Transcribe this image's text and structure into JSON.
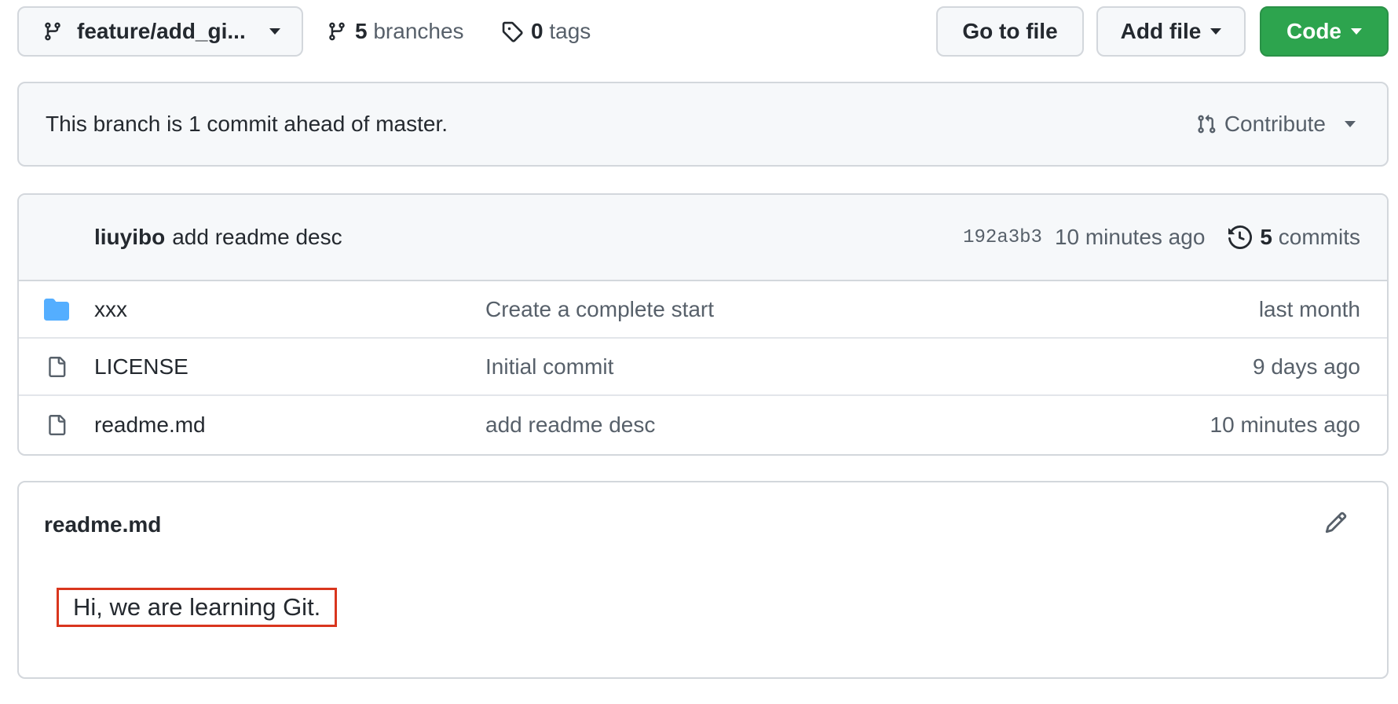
{
  "toolbar": {
    "branch_name": "feature/add_gi...",
    "branches_count": "5",
    "branches_label": "branches",
    "tags_count": "0",
    "tags_label": "tags",
    "go_to_file_label": "Go to file",
    "add_file_label": "Add file",
    "code_label": "Code"
  },
  "banner": {
    "ahead_text": "This branch is 1 commit ahead of master.",
    "contribute_label": "Contribute"
  },
  "latest_commit": {
    "author": "liuyibo",
    "message": "add readme desc",
    "sha": "192a3b3",
    "time": "10 minutes ago",
    "commits_count": "5",
    "commits_label": "commits"
  },
  "files": [
    {
      "type": "folder",
      "icon": "folder-icon",
      "name": "xxx",
      "message": "Create a complete start",
      "age": "last month"
    },
    {
      "type": "file",
      "icon": "file-icon",
      "name": "LICENSE",
      "message": "Initial commit",
      "age": "9 days ago"
    },
    {
      "type": "file",
      "icon": "file-icon",
      "name": "readme.md",
      "message": "add readme desc",
      "age": "10 minutes ago"
    }
  ],
  "readme": {
    "title": "readme.md",
    "content": "Hi, we are learning Git."
  },
  "colors": {
    "code_button": "#2da44e",
    "folder": "#54aeff",
    "highlight_border": "#d9361e",
    "border": "#d3d7dc"
  }
}
